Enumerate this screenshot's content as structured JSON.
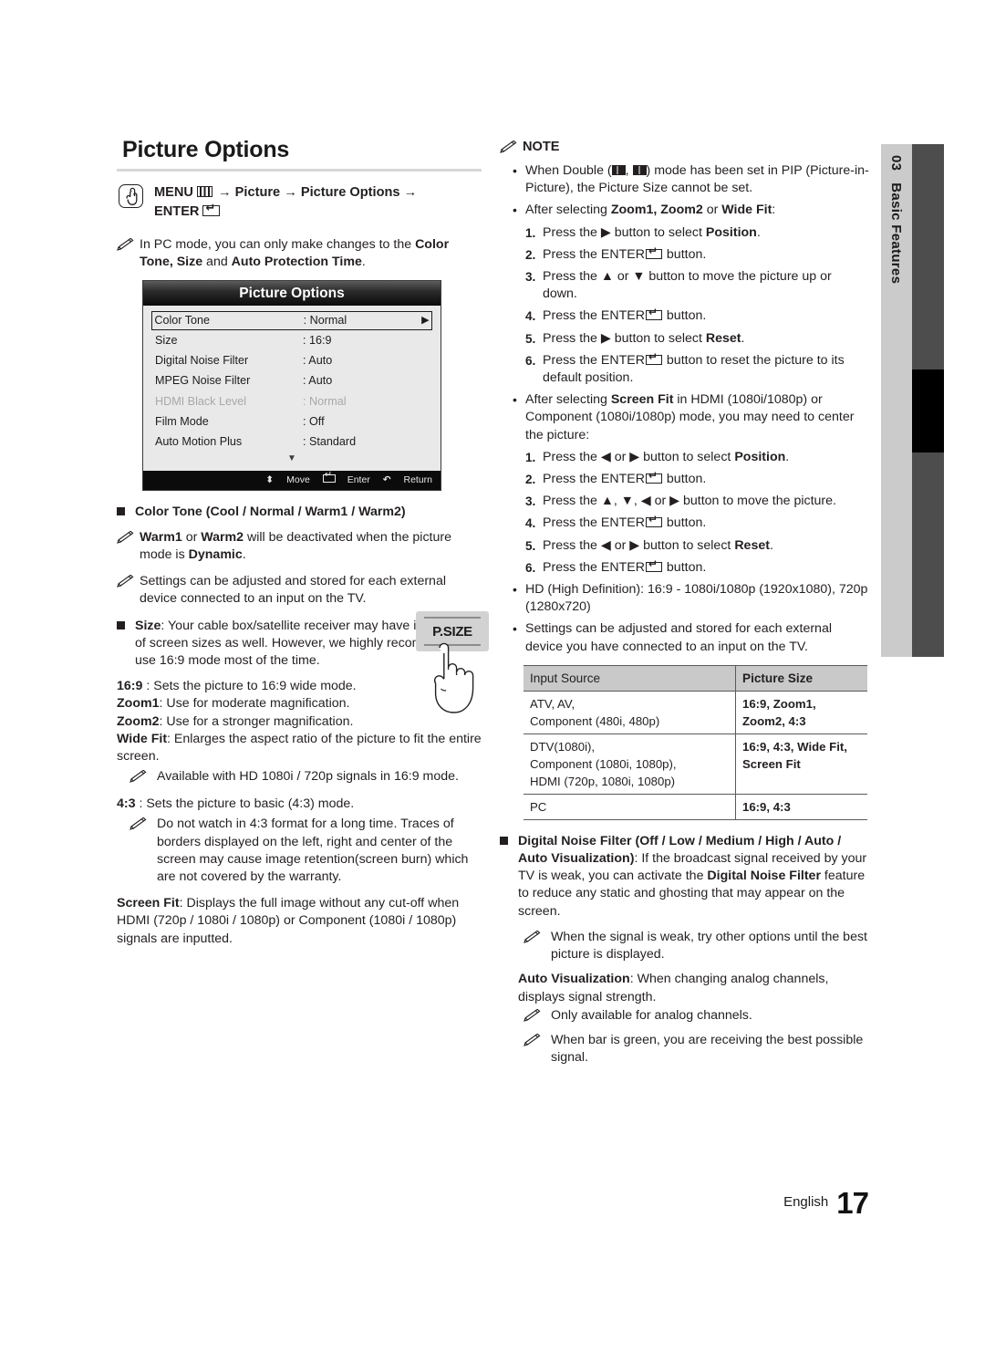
{
  "page": {
    "title": "Picture Options",
    "footer_language": "English",
    "footer_page": "17"
  },
  "side_tab": {
    "chapter_number": "03",
    "chapter_title": "Basic Features"
  },
  "menu_path": {
    "prefix": "MENU",
    "menu_icon": "menu-grid-icon",
    "segments": " → Picture → Picture Options → ",
    "enter": "ENTER",
    "enter_icon": "enter-key-icon"
  },
  "left": {
    "pc_note": {
      "part1": "In PC mode, you can only make changes to the ",
      "bold1": "Color Tone, Size",
      "mid": " and ",
      "bold2": "Auto Protection Time",
      "end": "."
    },
    "osd": {
      "header": "Picture Options",
      "rows": [
        {
          "label": "Color Tone",
          "value": ": Normal",
          "selected": true,
          "arrow": "▶",
          "dim": false
        },
        {
          "label": "Size",
          "value": ": 16:9",
          "selected": false,
          "arrow": "",
          "dim": false
        },
        {
          "label": "Digital Noise Filter",
          "value": ": Auto",
          "selected": false,
          "arrow": "",
          "dim": false
        },
        {
          "label": "MPEG Noise Filter",
          "value": ": Auto",
          "selected": false,
          "arrow": "",
          "dim": false
        },
        {
          "label": "HDMI Black Level",
          "value": ": Normal",
          "selected": false,
          "arrow": "",
          "dim": true
        },
        {
          "label": "Film Mode",
          "value": ": Off",
          "selected": false,
          "arrow": "",
          "dim": false
        },
        {
          "label": "Auto Motion Plus",
          "value": ": Standard",
          "selected": false,
          "arrow": "",
          "dim": false
        }
      ],
      "scroll_down_glyph": "▼",
      "footer": {
        "move": "Move",
        "enter": "Enter",
        "return": "Return",
        "move_glyph": "⬍",
        "return_glyph": "↶"
      }
    },
    "color_tone_heading": "Color Tone (Cool / Normal / Warm1 / Warm2)",
    "note_warm": {
      "bold1": "Warm1",
      "mid1": " or ",
      "bold2": "Warm2",
      "mid2": " will be deactivated when the picture mode is ",
      "bold3": "Dynamic",
      "end": "."
    },
    "note_settings": "Settings can be adjusted and stored for each external device connected to an input on the TV.",
    "size_heading_bold": "Size",
    "size_heading_rest": ": Your cable box/satellite receiver may have its own set of screen sizes as well. However, we highly recommend you use 16:9 mode most of the time.",
    "psize_button_label": "P.SIZE",
    "size_modes": [
      {
        "term": "16:9 ",
        "desc": ": Sets the picture to 16:9 wide mode."
      },
      {
        "term": "Zoom1",
        "desc": ": Use for moderate magnification."
      },
      {
        "term": "Zoom2",
        "desc": ": Use for a stronger magnification."
      },
      {
        "term": "Wide Fit",
        "desc": ": Enlarges the aspect ratio of the picture to fit the entire screen."
      }
    ],
    "note_widefit": "Available with HD 1080i / 720p signals in 16:9 mode.",
    "mode_43": {
      "term": "4:3 ",
      "desc": ": Sets the picture to basic (4:3) mode."
    },
    "note_43": "Do not watch in 4:3 format for a long time. Traces of borders displayed on the left, right and center of the screen may cause image retention(screen burn) which are not covered by the warranty.",
    "screen_fit": {
      "bold": "Screen Fit",
      "rest": ": Displays the full image without any cut-off when HDMI (720p / 1080i / 1080p) or Component (1080i / 1080p) signals are inputted."
    }
  },
  "right": {
    "note_heading": "NOTE",
    "note_double": {
      "pre": "When Double (",
      "icon1": "pip-double-wide-icon",
      "sep": ", ",
      "icon2": "pip-double-even-icon",
      "post": ") mode has been set in PIP (Picture-in-Picture), the Picture Size cannot be set."
    },
    "note_zoom_intro": {
      "pre": "After selecting ",
      "bold": "Zoom1, Zoom2",
      "mid": " or ",
      "bold2": "Wide Fit",
      "post": ":"
    },
    "zoom_steps": [
      {
        "num": "1.",
        "pre": "Press the ▶ button to select ",
        "bold": "Position",
        "post": "."
      },
      {
        "num": "2.",
        "pre": "Press the ENTER",
        "icon": "enter-key-icon",
        "post": " button."
      },
      {
        "num": "3.",
        "pre": "Press the ▲ or ▼ button to move the picture up or down.",
        "post": ""
      },
      {
        "num": "4.",
        "pre": "Press the ENTER",
        "icon": "enter-key-icon",
        "post": " button."
      },
      {
        "num": "5.",
        "pre": "Press the ▶ button to select ",
        "bold": "Reset",
        "post": "."
      },
      {
        "num": "6.",
        "pre": "Press the ENTER",
        "icon": "enter-key-icon",
        "post": " button to reset the picture to its default position."
      }
    ],
    "note_screenfit_intro": {
      "pre": "After selecting ",
      "bold": "Screen Fit",
      "post": " in HDMI (1080i/1080p) or Component (1080i/1080p) mode, you may need to center the picture:"
    },
    "screenfit_steps": [
      {
        "num": "1.",
        "pre": "Press the ◀ or ▶ button to select ",
        "bold": "Position",
        "post": "."
      },
      {
        "num": "2.",
        "pre": "Press the ENTER",
        "icon": "enter-key-icon",
        "post": " button."
      },
      {
        "num": "3.",
        "pre": "Press the ▲, ▼, ◀ or ▶ button to move the picture.",
        "post": ""
      },
      {
        "num": "4.",
        "pre": "Press the ENTER",
        "icon": "enter-key-icon",
        "post": " button."
      },
      {
        "num": "5.",
        "pre": "Press the ◀ or ▶ button to select ",
        "bold": "Reset",
        "post": "."
      },
      {
        "num": "6.",
        "pre": "Press the ENTER",
        "icon": "enter-key-icon",
        "post": " button."
      }
    ],
    "note_hd": "HD (High Definition): 16:9 - 1080i/1080p (1920x1080), 720p (1280x720)",
    "note_settings": "Settings can be adjusted and stored for each external device you have connected to an input on the TV.",
    "table": {
      "headers": [
        "Input Source",
        "Picture Size"
      ],
      "rows": [
        {
          "source": "ATV, AV,\nComponent (480i, 480p)",
          "size": "16:9, Zoom1,\nZoom2, 4:3"
        },
        {
          "source": "DTV(1080i),\nComponent (1080i, 1080p),\nHDMI (720p, 1080i, 1080p)",
          "size": "16:9, 4:3, Wide Fit,\nScreen Fit"
        },
        {
          "source": "PC",
          "size": "16:9, 4:3"
        }
      ]
    },
    "dnf": {
      "bold": "Digital Noise Filter (Off / Low / Medium / High / Auto / Auto Visualization)",
      "rest1": ": If the broadcast signal received by your TV is weak, you can activate the ",
      "bold2": "Digital Noise Filter",
      "rest2": " feature to reduce any static and ghosting that may appear on the screen."
    },
    "note_weak": "When the signal is weak, try other options until the best picture is displayed.",
    "auto_vis": {
      "bold": "Auto Visualization",
      "rest": ": When changing analog channels, displays signal strength."
    },
    "note_analog": "Only available for analog channels.",
    "note_green": "When bar is green, you are receiving the best possible signal."
  }
}
